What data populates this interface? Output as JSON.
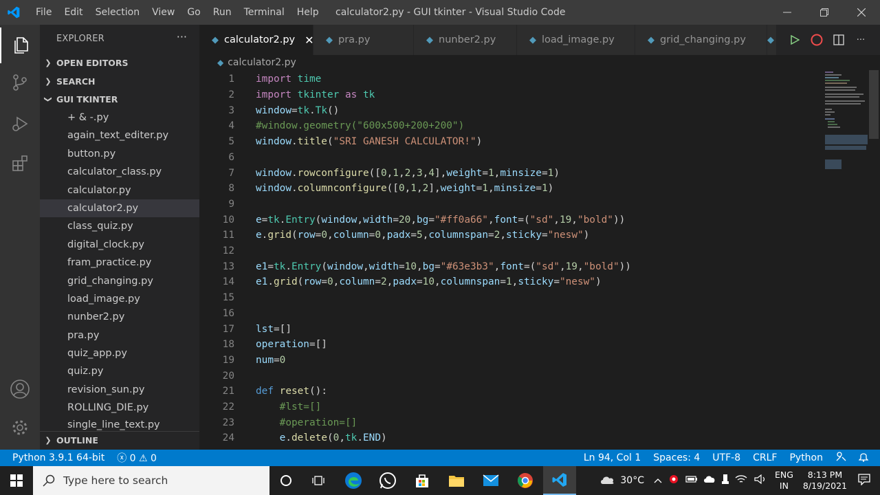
{
  "titlebar": {
    "menu": [
      "File",
      "Edit",
      "Selection",
      "View",
      "Go",
      "Run",
      "Terminal",
      "Help"
    ],
    "title": "calculator2.py - GUI tkinter - Visual Studio Code"
  },
  "sidebar": {
    "title": "EXPLORER",
    "more": "···",
    "open_editors": "OPEN EDITORS",
    "search": "SEARCH",
    "folder": "GUI TKINTER",
    "outline": "OUTLINE",
    "files": [
      "+ & -.py",
      "again_text_editer.py",
      "button.py",
      "calculator_class.py",
      "calculator.py",
      "calculator2.py",
      "class_quiz.py",
      "digital_clock.py",
      "fram_practice.py",
      "grid_changing.py",
      "load_image.py",
      "nunber2.py",
      "pra.py",
      "quiz_app.py",
      "quiz.py",
      "revision_sun.py",
      "ROLLING_DIE.py",
      "single_line_text.py"
    ],
    "selected_file": "calculator2.py"
  },
  "tabs": [
    {
      "label": "calculator2.py",
      "active": true
    },
    {
      "label": "pra.py",
      "active": false
    },
    {
      "label": "nunber2.py",
      "active": false
    },
    {
      "label": "load_image.py",
      "active": false
    },
    {
      "label": "grid_changing.py",
      "active": false
    }
  ],
  "breadcrumb": "calculator2.py",
  "editor": {
    "line_numbers": [
      "1",
      "2",
      "3",
      "4",
      "5",
      "6",
      "7",
      "8",
      "9",
      "10",
      "11",
      "12",
      "13",
      "14",
      "15",
      "16",
      "17",
      "18",
      "19",
      "20",
      "21",
      "22",
      "23",
      "24"
    ]
  },
  "statusbar": {
    "python": "Python 3.9.1 64-bit",
    "errors": "0",
    "warnings": "0",
    "position": "Ln 94, Col 1",
    "spaces": "Spaces: 4",
    "encoding": "UTF-8",
    "eol": "CRLF",
    "language": "Python"
  },
  "taskbar": {
    "search_placeholder": "Type here to search",
    "temperature": "30°C",
    "lang": "ENG",
    "region": "IN",
    "time": "8:13 PM",
    "date": "8/19/2021"
  },
  "colors": {
    "accent": "#007acc",
    "titlebar": "#3c3c3c",
    "sidebar": "#252526",
    "editor": "#1e1e1e"
  }
}
